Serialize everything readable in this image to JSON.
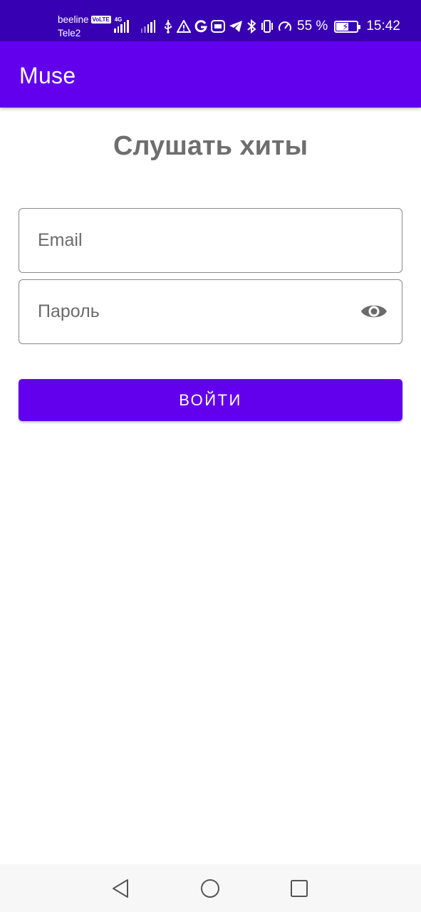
{
  "status_bar": {
    "carrier_1": "beeline",
    "volte_badge": "VoLTE",
    "network_type": "4G",
    "carrier_2": "Tele2",
    "battery_percent": "55 %",
    "battery_level": 0.55,
    "time": "15:42",
    "icons": [
      "signal-icon",
      "signal-icon",
      "usb-icon",
      "warning-icon",
      "google-icon",
      "vpn-icon",
      "telegram-icon",
      "bluetooth-icon",
      "vibrate-icon",
      "speedometer-icon",
      "battery-icon"
    ]
  },
  "app_bar": {
    "title": "Muse",
    "color": "#6200ee"
  },
  "main": {
    "heading": "Слушать хиты",
    "email": {
      "placeholder": "Email",
      "value": ""
    },
    "password": {
      "placeholder": "Пароль",
      "value": "",
      "toggle_icon": "eye-icon"
    },
    "login_button": {
      "label": "ВОЙТИ"
    }
  },
  "nav_bar": {
    "buttons": [
      "back-icon",
      "home-icon",
      "recents-icon"
    ]
  },
  "colors": {
    "status_bar": "#3700b3",
    "primary": "#6200ee",
    "heading_text": "#6e6e6e",
    "border": "#8a8a8a"
  }
}
